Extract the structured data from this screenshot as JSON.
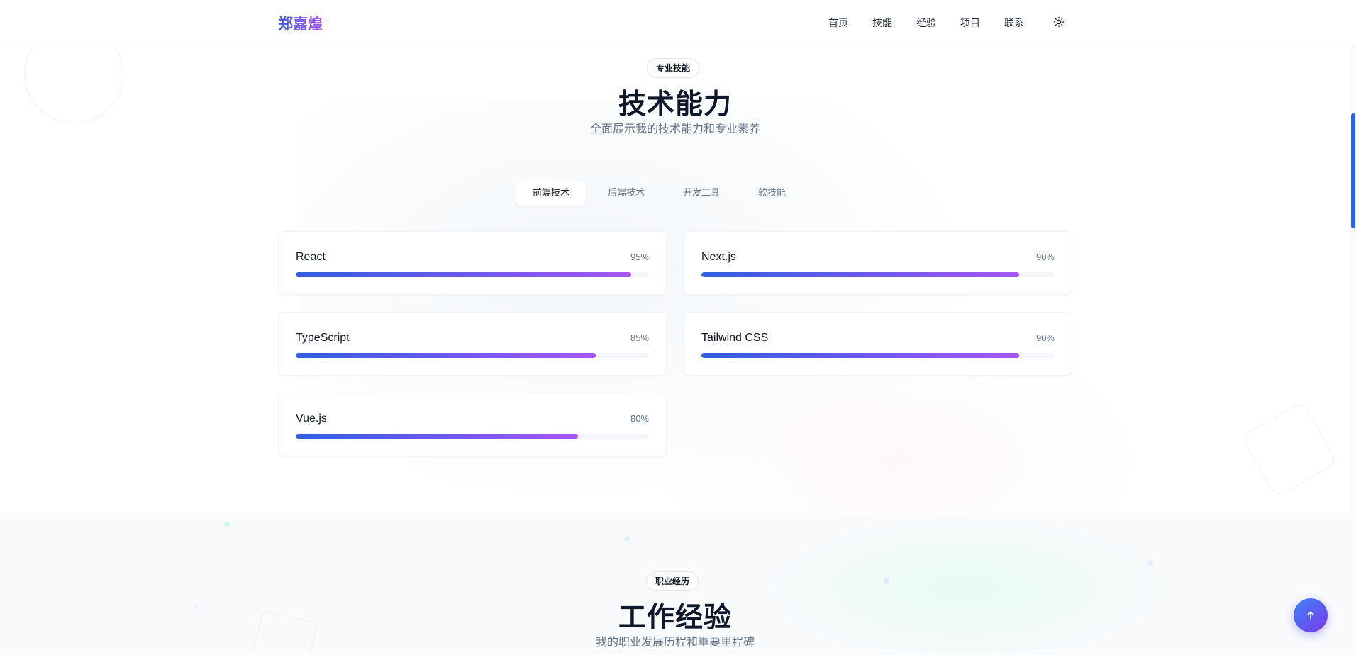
{
  "nav": {
    "logo": "郑嘉煌",
    "links": [
      "首页",
      "技能",
      "经验",
      "项目",
      "联系"
    ],
    "theme_icon": "sun-icon"
  },
  "skills_section": {
    "badge": "专业技能",
    "title": "技术能力",
    "subtitle": "全面展示我的技术能力和专业素养",
    "tabs": [
      "前端技术",
      "后端技术",
      "开发工具",
      "软技能"
    ],
    "active_tab": "前端技术",
    "skills": [
      {
        "name": "React",
        "percent_label": "95%",
        "level": 0.95
      },
      {
        "name": "Next.js",
        "percent_label": "90%",
        "level": 0.9
      },
      {
        "name": "TypeScript",
        "percent_label": "85%",
        "level": 0.85
      },
      {
        "name": "Tailwind CSS",
        "percent_label": "90%",
        "level": 0.9
      },
      {
        "name": "Vue.js",
        "percent_label": "80%",
        "level": 0.8
      }
    ]
  },
  "experience_section": {
    "badge": "职业经历",
    "title": "工作经验",
    "subtitle": "我的职业发展历程和重要里程碑"
  },
  "scroll_top": {
    "icon": "arrow-up-icon"
  },
  "colors": {
    "accent_start": "#2f5fe0",
    "accent_end": "#a855f7",
    "scrollbar": "#2563eb"
  }
}
